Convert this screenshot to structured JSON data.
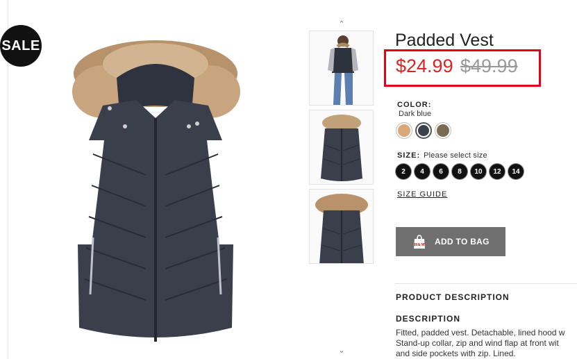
{
  "badge": {
    "sale": "SALE"
  },
  "product": {
    "title": "Padded Vest",
    "price_sale": "$24.99",
    "price_original": "$49.99",
    "highlight_color": "#e3001b"
  },
  "color": {
    "label": "COLOR:",
    "selected_name": "Dark blue",
    "swatches": [
      "#d8a878",
      "#3c404b",
      "#7a6a52"
    ]
  },
  "size": {
    "label": "SIZE:",
    "hint": "Please select size",
    "options": [
      "2",
      "4",
      "6",
      "8",
      "10",
      "12",
      "14"
    ]
  },
  "size_guide": "SIZE GUIDE",
  "add_to_bag": {
    "label": "ADD TO BAG",
    "bag_text": "H&M"
  },
  "sections": {
    "product_description": "PRODUCT DESCRIPTION",
    "description": "DESCRIPTION",
    "description_lines": [
      "Fitted, padded vest. Detachable, lined hood w",
      "Stand-up collar, zip and wind flap at front wit",
      "and side pockets with zip. Lined."
    ]
  },
  "icons": {
    "thumb_up": "chevron-up-icon",
    "thumb_down": "chevron-down-icon",
    "bag": "shopping-bag-icon"
  }
}
